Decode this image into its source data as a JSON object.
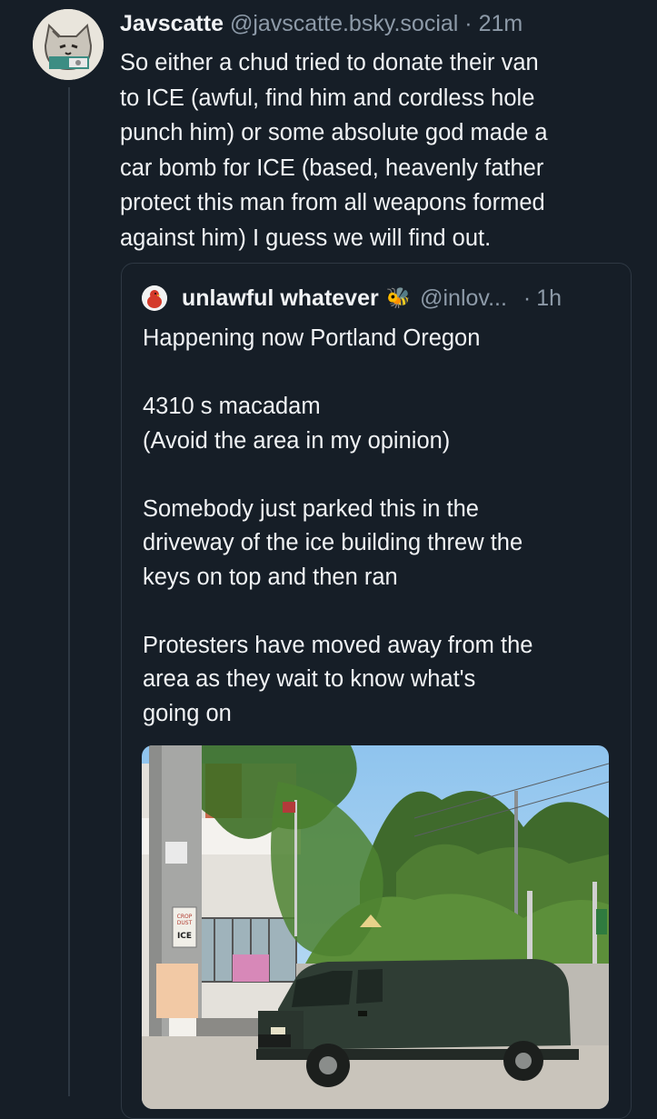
{
  "post": {
    "author_name": "Javscatte",
    "handle": "@javscatte.bsky.social",
    "separator": "·",
    "time": "21m",
    "text_lines": [
      "So either a chud tried to donate their van",
      "to ICE (awful, find him and cordless hole",
      "punch him) or some absolute god made a",
      "car bomb for ICE (based, heavenly father",
      "protect this man from all weapons formed",
      "against him) I guess we will find out."
    ],
    "avatar_icon": "cat-avatar-icon"
  },
  "quote": {
    "author_name": "unlawful whatever",
    "badge": "🐝",
    "handle": "@inlov...",
    "separator": "·",
    "time": "1h",
    "avatar_icon": "red-bird-avatar-icon",
    "text_lines": [
      "Happening now Portland Oregon",
      "",
      "4310 s macadam",
      "(Avoid the area in my opinion)",
      "",
      "Somebody just parked this in the",
      "driveway of the ice building threw the",
      "keys on top and then ran",
      "",
      "Protesters have moved away from the",
      "area as they wait to know what's",
      "going on"
    ],
    "image": {
      "icon": "van-photo-image",
      "sign_lines": [
        "CROP",
        "DUST",
        "ICE"
      ]
    }
  },
  "colors": {
    "background": "#161e27",
    "text": "#f1f3f5",
    "muted": "#8d9aa8",
    "border": "#2e3843"
  }
}
